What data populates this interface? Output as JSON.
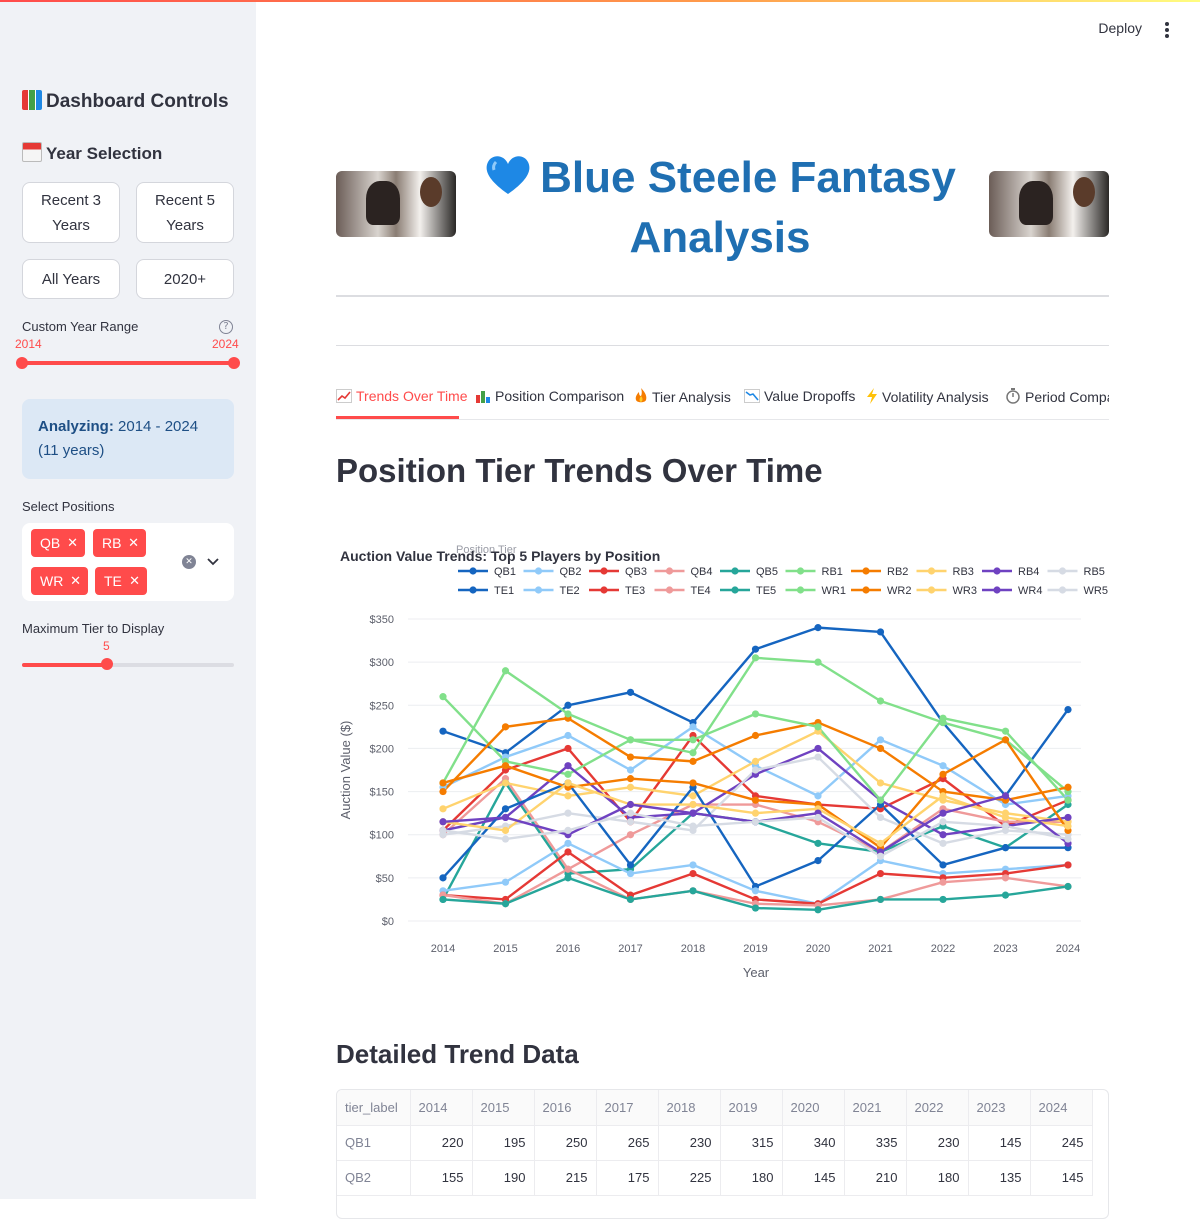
{
  "header": {
    "deploy_label": "Deploy"
  },
  "sidebar": {
    "title": "Dashboard Controls",
    "year_section": "Year Selection",
    "buttons": [
      "Recent 3 Years",
      "Recent 5 Years",
      "All Years",
      "2020+"
    ],
    "custom_range_label": "Custom Year Range",
    "range_min": "2014",
    "range_max": "2024",
    "info_label": "Analyzing:",
    "info_value": "2014 - 2024 (11 years)",
    "positions_label": "Select Positions",
    "positions": [
      "QB",
      "RB",
      "WR",
      "TE"
    ],
    "max_tier_label": "Maximum Tier to Display",
    "max_tier_value": "5",
    "max_tier_fraction": 0.4
  },
  "main": {
    "title": "Blue Steele Fantasy Analysis",
    "tabs": [
      "Trends Over Time",
      "Position Comparison",
      "Tier Analysis",
      "Value Dropoffs",
      "Volatility Analysis",
      "Period Compa"
    ],
    "section_title": "Position Tier Trends Over Time",
    "table_title": "Detailed Trend Data"
  },
  "chart_data": {
    "type": "line",
    "title": "Auction Value Trends: Top 5 Players by Position",
    "legend_title": "Position Tier",
    "xlabel": "Year",
    "ylabel": "Auction Value ($)",
    "ylim": [
      0,
      350
    ],
    "yticks": [
      "$0",
      "$50",
      "$100",
      "$150",
      "$200",
      "$250",
      "$300",
      "$350"
    ],
    "x": [
      2014,
      2015,
      2016,
      2017,
      2018,
      2019,
      2020,
      2021,
      2022,
      2023,
      2024
    ],
    "legend_placement": "top",
    "series": [
      {
        "name": "QB1",
        "color": "#1565c0",
        "values": [
          220,
          195,
          250,
          265,
          230,
          315,
          340,
          335,
          230,
          145,
          245
        ]
      },
      {
        "name": "QB2",
        "color": "#90caf9",
        "values": [
          155,
          190,
          215,
          175,
          225,
          180,
          145,
          210,
          180,
          135,
          145
        ]
      },
      {
        "name": "QB3",
        "color": "#e53935",
        "values": [
          105,
          175,
          200,
          115,
          215,
          145,
          135,
          130,
          165,
          110,
          140
        ]
      },
      {
        "name": "QB4",
        "color": "#ef9a9a",
        "values": [
          100,
          165,
          60,
          100,
          135,
          135,
          115,
          80,
          130,
          115,
          115
        ]
      },
      {
        "name": "QB5",
        "color": "#26a69a",
        "values": [
          25,
          160,
          55,
          60,
          125,
          115,
          90,
          80,
          110,
          85,
          135
        ]
      },
      {
        "name": "RB1",
        "color": "#81e08a",
        "values": [
          260,
          185,
          170,
          210,
          195,
          305,
          300,
          255,
          230,
          210,
          150
        ]
      },
      {
        "name": "RB2",
        "color": "#f57c00",
        "values": [
          150,
          225,
          235,
          190,
          185,
          215,
          230,
          200,
          150,
          140,
          155
        ]
      },
      {
        "name": "RB3",
        "color": "#ffd36e",
        "values": [
          130,
          160,
          145,
          155,
          145,
          185,
          220,
          160,
          140,
          125,
          115
        ]
      },
      {
        "name": "RB4",
        "color": "#6f42c1",
        "values": [
          105,
          120,
          180,
          120,
          125,
          170,
          200,
          140,
          100,
          110,
          120
        ]
      },
      {
        "name": "RB5",
        "color": "#d6dbe4",
        "values": [
          100,
          110,
          125,
          115,
          105,
          175,
          190,
          120,
          90,
          105,
          100
        ]
      },
      {
        "name": "TE1",
        "color": "#1565c0",
        "values": [
          50,
          130,
          160,
          65,
          155,
          40,
          70,
          135,
          65,
          85,
          85
        ]
      },
      {
        "name": "TE2",
        "color": "#90caf9",
        "values": [
          35,
          45,
          90,
          55,
          65,
          35,
          20,
          70,
          55,
          60,
          65
        ]
      },
      {
        "name": "TE3",
        "color": "#e53935",
        "values": [
          30,
          25,
          80,
          30,
          55,
          25,
          20,
          55,
          50,
          55,
          65
        ]
      },
      {
        "name": "TE4",
        "color": "#ef9a9a",
        "values": [
          30,
          20,
          60,
          25,
          35,
          20,
          18,
          25,
          45,
          50,
          40
        ]
      },
      {
        "name": "TE5",
        "color": "#26a69a",
        "values": [
          25,
          20,
          50,
          25,
          35,
          15,
          13,
          25,
          25,
          30,
          40
        ]
      },
      {
        "name": "WR1",
        "color": "#81e08a",
        "values": [
          160,
          290,
          240,
          210,
          210,
          240,
          225,
          140,
          235,
          220,
          140
        ]
      },
      {
        "name": "WR2",
        "color": "#f57c00",
        "values": [
          160,
          180,
          155,
          165,
          160,
          140,
          135,
          85,
          170,
          210,
          105
        ]
      },
      {
        "name": "WR3",
        "color": "#ffd36e",
        "values": [
          115,
          105,
          160,
          135,
          135,
          125,
          130,
          90,
          145,
          120,
          110
        ]
      },
      {
        "name": "WR4",
        "color": "#6f42c1",
        "values": [
          115,
          120,
          100,
          135,
          125,
          115,
          125,
          80,
          125,
          145,
          90
        ]
      },
      {
        "name": "WR5",
        "color": "#d6dbe4",
        "values": [
          105,
          95,
          105,
          125,
          110,
          115,
          120,
          75,
          115,
          110,
          95
        ]
      }
    ]
  },
  "table": {
    "columns": [
      "tier_label",
      "2014",
      "2015",
      "2016",
      "2017",
      "2018",
      "2019",
      "2020",
      "2021",
      "2022",
      "2023",
      "2024"
    ],
    "rows": [
      [
        "QB1",
        "220",
        "195",
        "250",
        "265",
        "230",
        "315",
        "340",
        "335",
        "230",
        "145",
        "245"
      ],
      [
        "QB2",
        "155",
        "190",
        "215",
        "175",
        "225",
        "180",
        "145",
        "210",
        "180",
        "135",
        "145"
      ]
    ]
  }
}
